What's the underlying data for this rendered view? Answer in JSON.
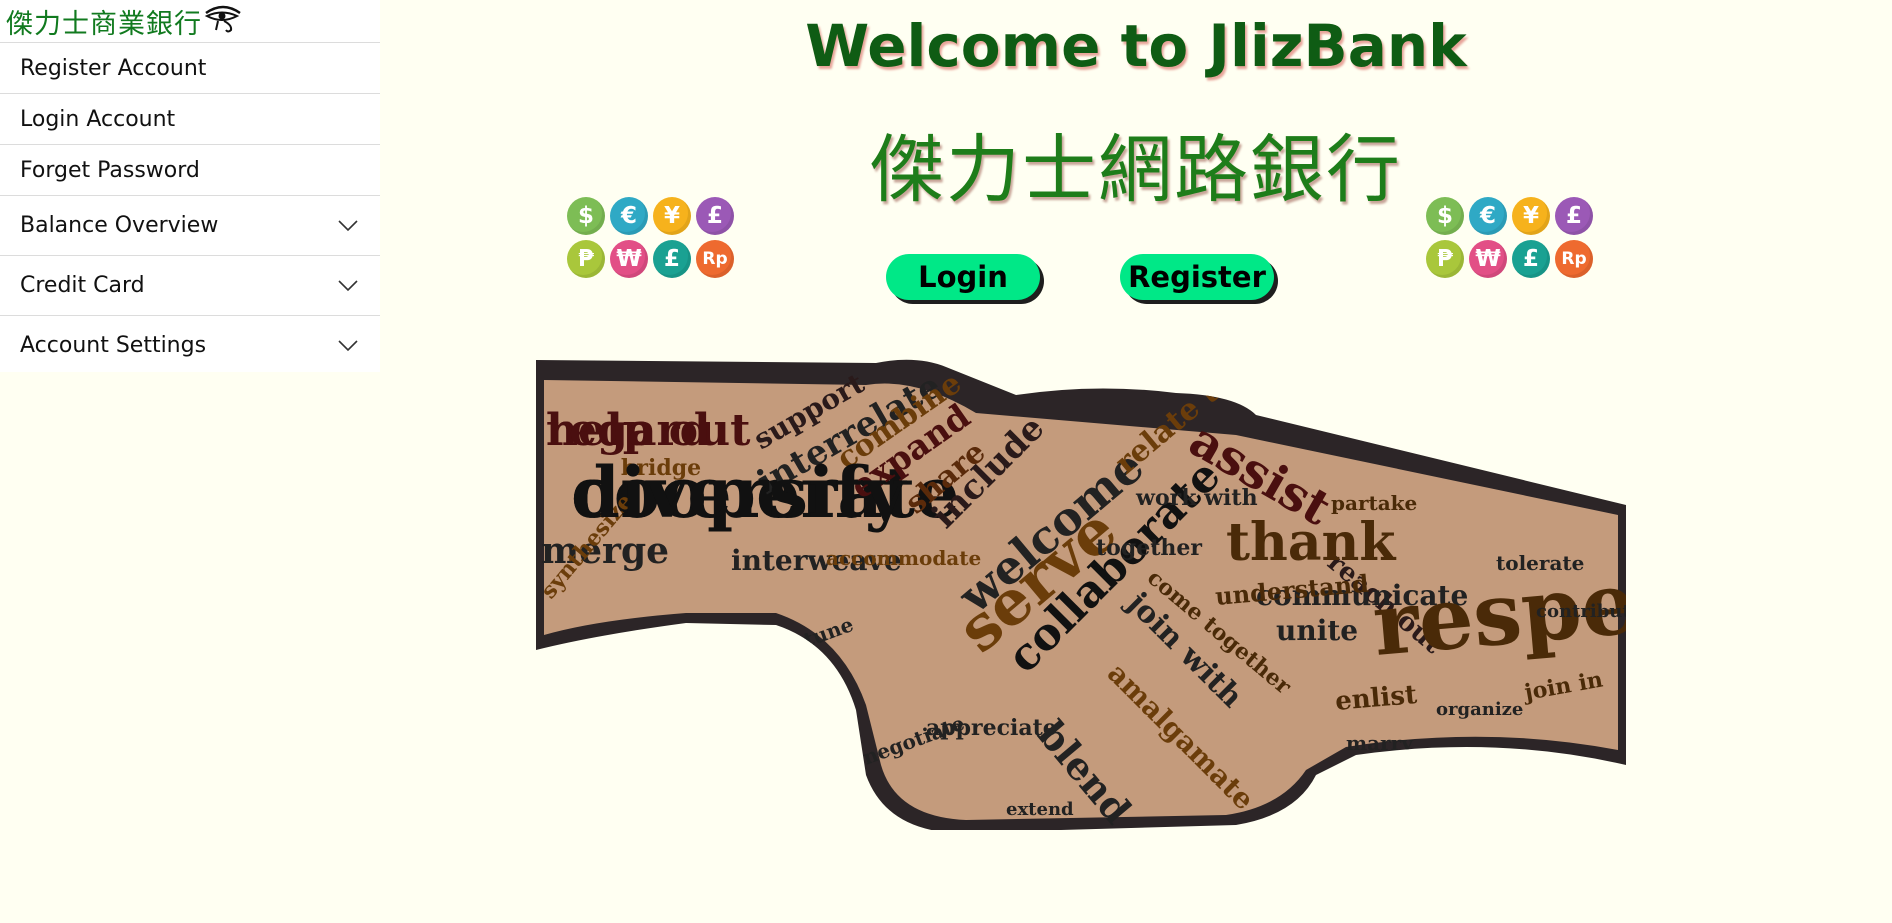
{
  "sidebar": {
    "brand": "傑力士商業銀行",
    "brand_icon": "eye-of-horus-icon",
    "items": [
      {
        "label": "Register Account",
        "expandable": false
      },
      {
        "label": "Login Account",
        "expandable": false
      },
      {
        "label": "Forget Password",
        "expandable": false
      },
      {
        "label": "Balance Overview",
        "expandable": true
      },
      {
        "label": "Credit Card",
        "expandable": true
      },
      {
        "label": "Account Settings",
        "expandable": true
      }
    ]
  },
  "main": {
    "title": "Welcome to JlizBank",
    "subtitle": "傑力士網路銀行",
    "login_button": "Login",
    "register_button": "Register",
    "coins": [
      {
        "symbol": "$",
        "color": "#7dbd55"
      },
      {
        "symbol": "€",
        "color": "#2fa9c5"
      },
      {
        "symbol": "¥",
        "color": "#f6b21c"
      },
      {
        "symbol": "£",
        "color": "#9b59b6"
      },
      {
        "symbol": "₱",
        "color": "#a9c73b"
      },
      {
        "symbol": "₩",
        "color": "#e24f86"
      },
      {
        "symbol": "£",
        "color": "#1aa192"
      },
      {
        "symbol": "Rp",
        "color": "#ee6a2f"
      }
    ],
    "art_words": [
      "help out",
      "cooperate",
      "merge",
      "interweave",
      "support",
      "interrelate",
      "combine",
      "expand",
      "share",
      "include",
      "welcome",
      "serve",
      "collaborate",
      "blend",
      "assist",
      "relate to",
      "reach out",
      "thank",
      "communicate",
      "understand",
      "respect",
      "unite",
      "enlist",
      "join in",
      "join with",
      "together",
      "come together",
      "amalgamate",
      "appreciate",
      "bridge",
      "work with",
      "partake",
      "tolerate",
      "contribute",
      "accommodate",
      "extend",
      "attune",
      "negotiate",
      "marry",
      "organize",
      "synthesize",
      "regard",
      "diversify"
    ]
  }
}
